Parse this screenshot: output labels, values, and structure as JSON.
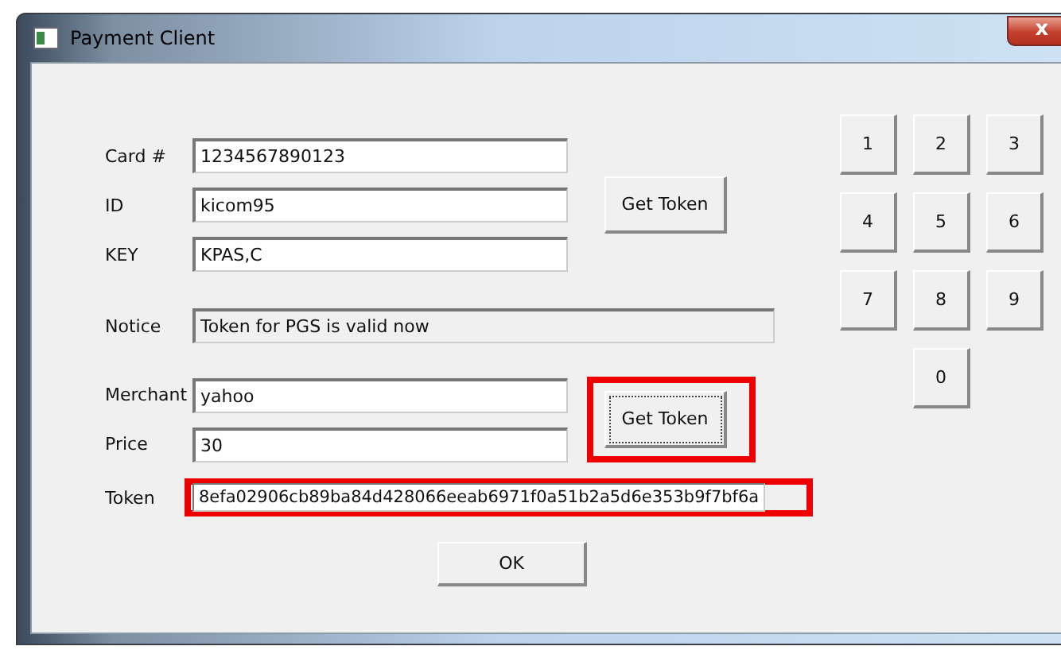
{
  "window": {
    "title": "Payment Client",
    "close": "x"
  },
  "card_fields": [
    {
      "label": "Card #",
      "value": "1234567890123"
    },
    {
      "label": "ID",
      "value": "kicom95"
    },
    {
      "label": "KEY",
      "value": "KPAS,C"
    }
  ],
  "card_button": {
    "label": "Get Token",
    "highlighted": false
  },
  "notice": {
    "label": "Notice",
    "value": "Token for PGS is valid now"
  },
  "order_fields": [
    {
      "label": "Merchant",
      "value": "yahoo"
    },
    {
      "label": "Price",
      "value": "30"
    }
  ],
  "order_button": {
    "label": "Get Token",
    "highlighted": true
  },
  "token": {
    "label": "Token",
    "value": "8efa02906cb89ba84d428066eeab6971f0a51b2a5d6e353b9f7bf6a",
    "highlighted": true
  },
  "ok_button": "OK",
  "keypad": [
    "1",
    "2",
    "3",
    "4",
    "5",
    "6",
    "7",
    "8",
    "9",
    "0"
  ]
}
